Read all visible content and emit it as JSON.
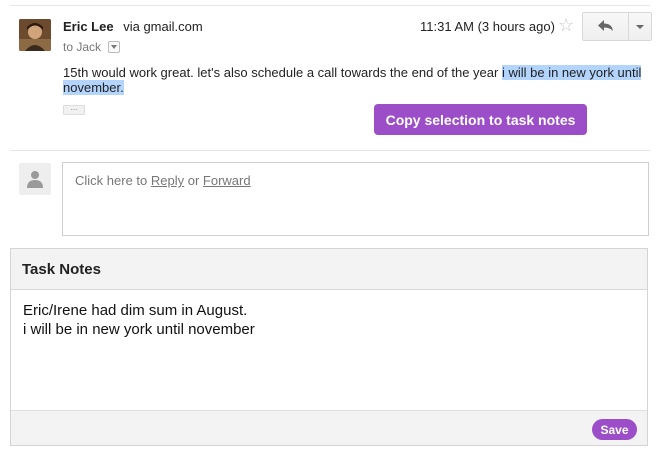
{
  "email": {
    "sender_name": "Eric Lee",
    "sender_via": "via gmail.com",
    "to_line": "to Jack",
    "time": "11:31 AM (3 hours ago)",
    "body_plain": "15th would work great. let's also schedule a call towards the end of the year ",
    "body_highlight": "i will be in new york until november.",
    "ellipsis": "..."
  },
  "actions": {
    "copy_selection": "Copy selection to task notes"
  },
  "reply": {
    "prefix": "Click here to ",
    "reply_link": "Reply",
    "or_text": " or ",
    "forward_link": "Forward"
  },
  "task_notes": {
    "title": "Task Notes",
    "line1": "Eric/Irene had dim sum in August.",
    "line2": "i will be in new york until november",
    "save_label": "Save"
  },
  "colors": {
    "accent": "#9b4ec8",
    "highlight": "#b3d4fc"
  }
}
